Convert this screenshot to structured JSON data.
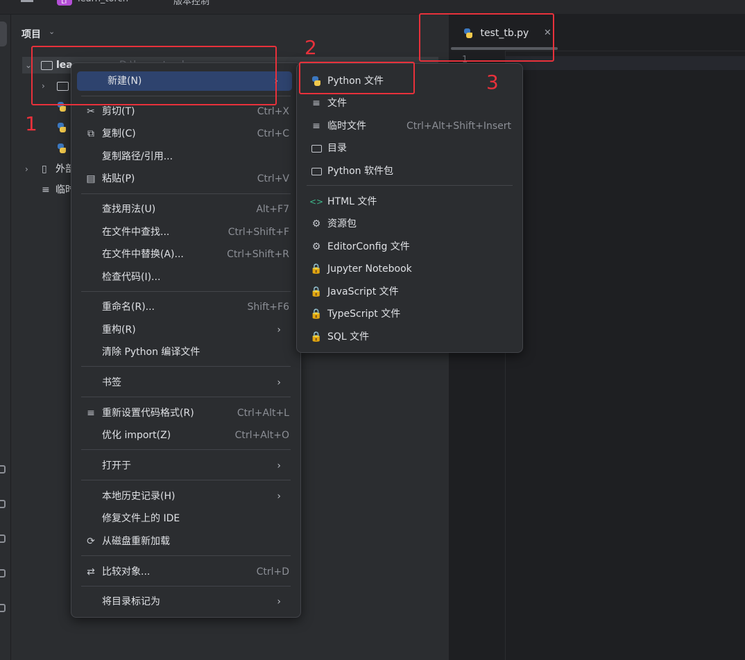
{
  "topbar": {
    "project_badge": "LT",
    "project_name": "learn_torch",
    "vcs": "版本控制"
  },
  "panel": {
    "title": "项目"
  },
  "tree": {
    "root_label": "lea",
    "root_hidden_path": "D:\\learn_torch",
    "external_label": "外部",
    "scratch_label": "临时"
  },
  "editor": {
    "tab_label": "test_tb.py",
    "line_number": "1"
  },
  "context_menu": {
    "items": [
      {
        "label": "新建(N)",
        "shortcut": "",
        "submenu": true
      },
      {
        "label": "剪切(T)",
        "shortcut": "Ctrl+X"
      },
      {
        "label": "复制(C)",
        "shortcut": "Ctrl+C"
      },
      {
        "label": "复制路径/引用...",
        "shortcut": ""
      },
      {
        "label": "粘贴(P)",
        "shortcut": "Ctrl+V"
      },
      {
        "label": "查找用法(U)",
        "shortcut": "Alt+F7"
      },
      {
        "label": "在文件中查找...",
        "shortcut": "Ctrl+Shift+F"
      },
      {
        "label": "在文件中替换(A)...",
        "shortcut": "Ctrl+Shift+R"
      },
      {
        "label": "检查代码(I)...",
        "shortcut": ""
      },
      {
        "label": "重命名(R)...",
        "shortcut": "Shift+F6"
      },
      {
        "label": "重构(R)",
        "shortcut": "",
        "submenu": true
      },
      {
        "label": "清除 Python 编译文件",
        "shortcut": ""
      },
      {
        "label": "书签",
        "shortcut": "",
        "submenu": true
      },
      {
        "label": "重新设置代码格式(R)",
        "shortcut": "Ctrl+Alt+L"
      },
      {
        "label": "优化 import(Z)",
        "shortcut": "Ctrl+Alt+O"
      },
      {
        "label": "打开于",
        "shortcut": "",
        "submenu": true
      },
      {
        "label": "本地历史记录(H)",
        "shortcut": "",
        "submenu": true
      },
      {
        "label": "修复文件上的 IDE",
        "shortcut": ""
      },
      {
        "label": "从磁盘重新加载",
        "shortcut": ""
      },
      {
        "label": "比较对象...",
        "shortcut": "Ctrl+D"
      },
      {
        "label": "将目录标记为",
        "shortcut": "",
        "submenu": true
      }
    ]
  },
  "submenu": {
    "items": [
      {
        "label": "Python 文件",
        "shortcut": ""
      },
      {
        "label": "文件",
        "shortcut": ""
      },
      {
        "label": "临时文件",
        "shortcut": "Ctrl+Alt+Shift+Insert"
      },
      {
        "label": "目录",
        "shortcut": ""
      },
      {
        "label": "Python 软件包",
        "shortcut": ""
      },
      {
        "label": "HTML 文件",
        "shortcut": ""
      },
      {
        "label": "资源包",
        "shortcut": ""
      },
      {
        "label": "EditorConfig 文件",
        "shortcut": ""
      },
      {
        "label": "Jupyter Notebook",
        "shortcut": ""
      },
      {
        "label": "JavaScript 文件",
        "shortcut": ""
      },
      {
        "label": "TypeScript 文件",
        "shortcut": ""
      },
      {
        "label": "SQL 文件",
        "shortcut": ""
      }
    ]
  },
  "annotations": {
    "n1": "1",
    "n2": "2",
    "n3": "3"
  },
  "colors": {
    "accent_highlight": "#2e436e",
    "annotation_red": "#e8313b",
    "lock_green": "#3fb98c"
  }
}
